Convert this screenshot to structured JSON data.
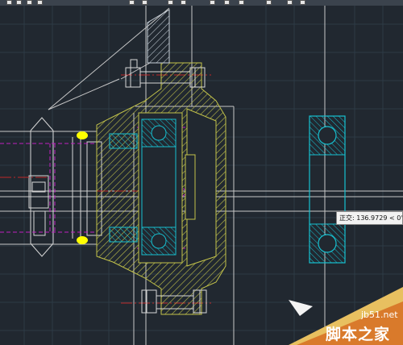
{
  "window": {
    "background": "#212830"
  },
  "toolbar": {
    "icons": [
      "save-icon",
      "print-icon",
      "undo-icon",
      "redo-icon",
      "match-properties-icon",
      "layer-icon",
      "properties-icon",
      "grid-icon",
      "snap-icon",
      "ortho-icon",
      "polar-icon",
      "osnap-icon"
    ]
  },
  "drawing": {
    "colors": {
      "cyan": "#16c0d0",
      "yellow_hatch": "#c2c24a",
      "magenta": "#c020c0",
      "red": "#c02828",
      "white": "#d8d8d8",
      "grid": "#2d3a45",
      "highlight": "#ffff00"
    }
  },
  "tooltip": {
    "text": "正交: 136.9729 < 0°"
  },
  "watermark": {
    "url": "jb51.net",
    "name": "脚本之家"
  }
}
